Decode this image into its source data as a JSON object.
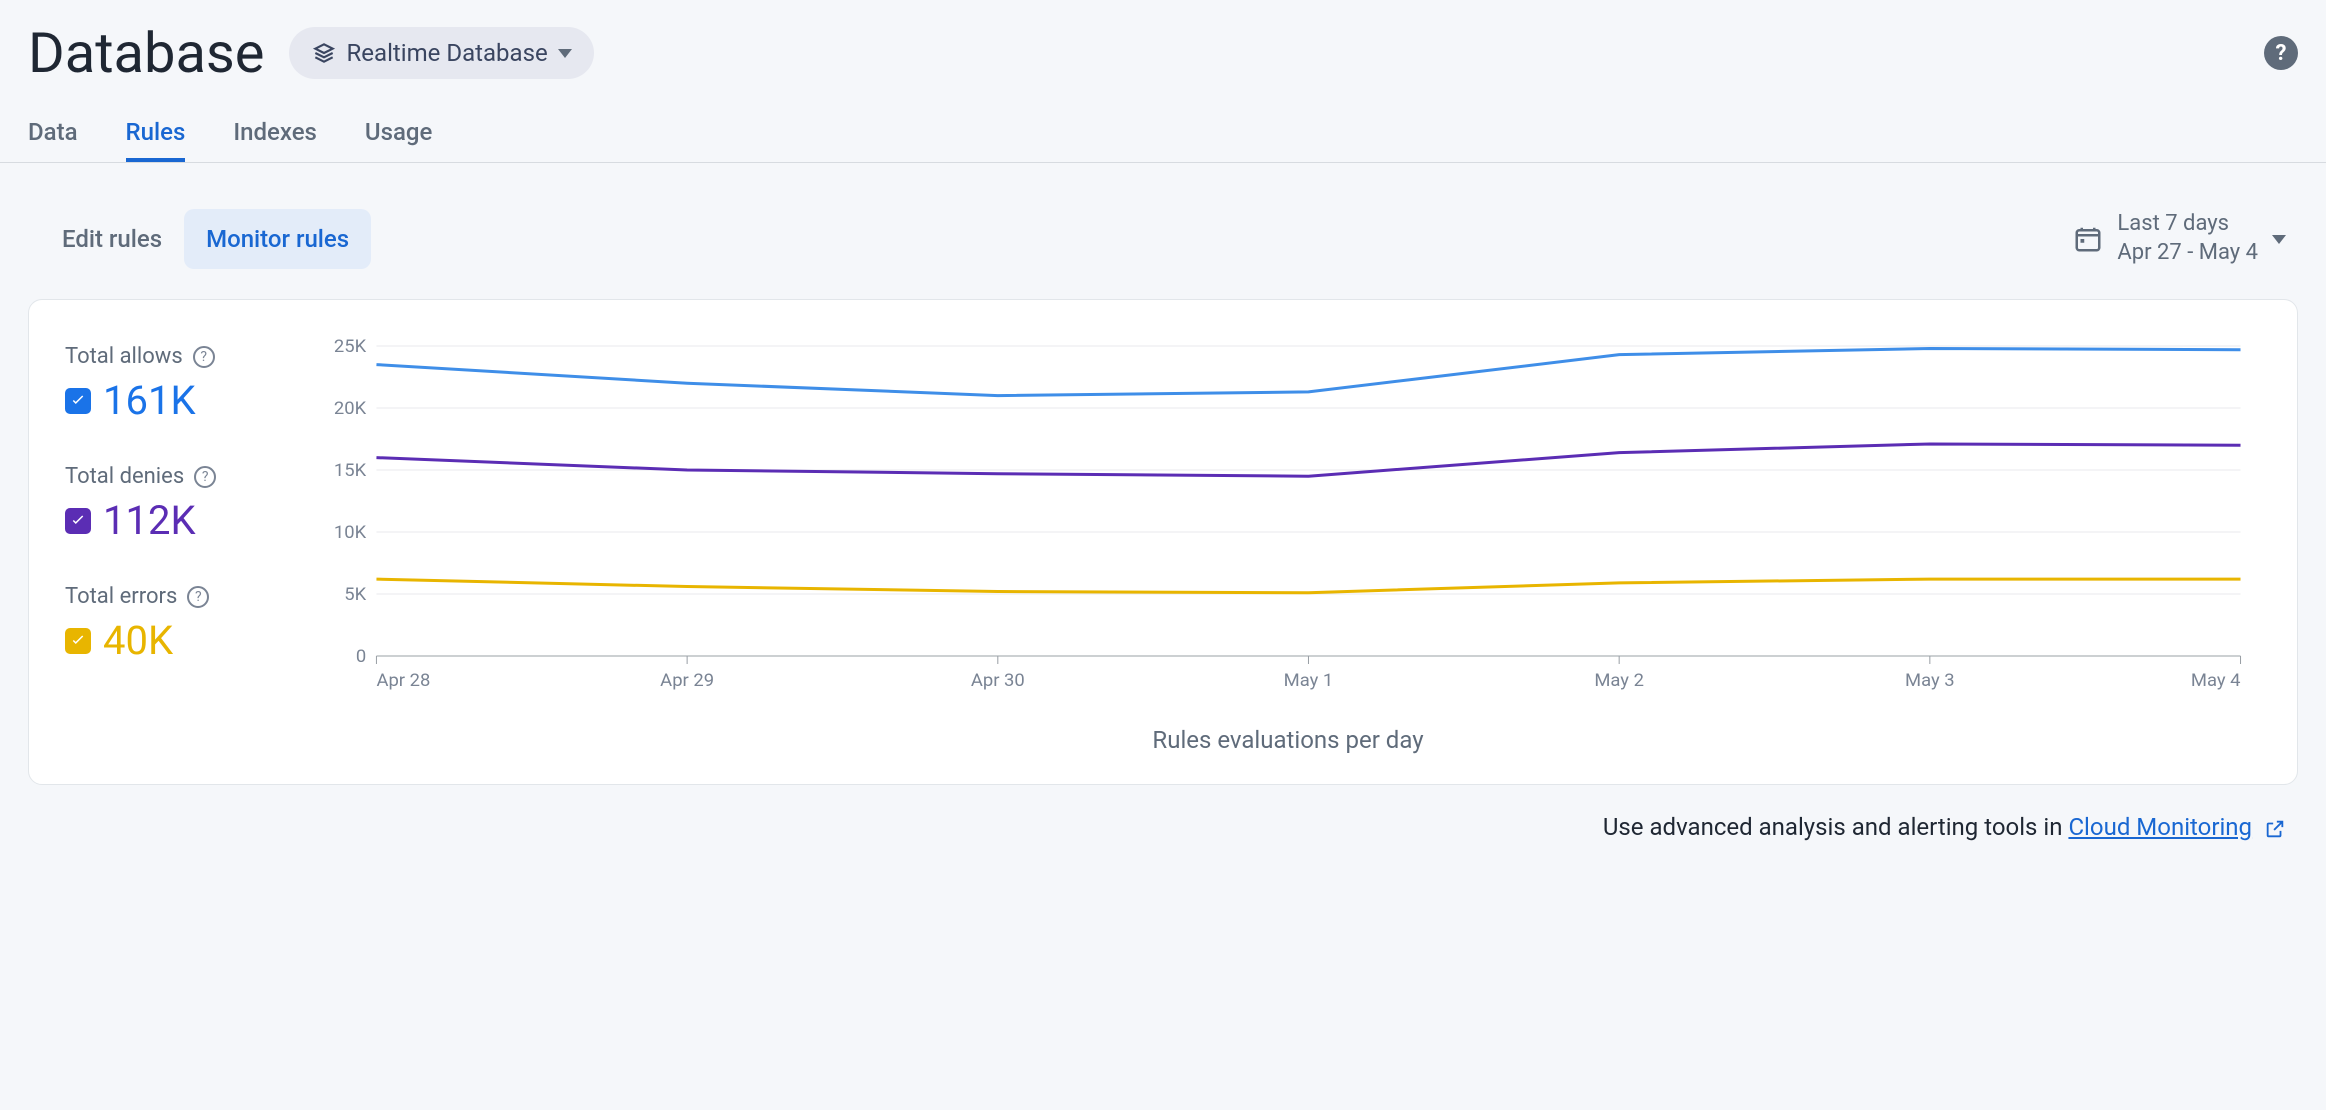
{
  "header": {
    "title": "Database",
    "db_selector_label": "Realtime Database"
  },
  "tabs": [
    "Data",
    "Rules",
    "Indexes",
    "Usage"
  ],
  "active_tab": "Rules",
  "subtabs": {
    "edit": "Edit rules",
    "monitor": "Monitor rules"
  },
  "active_subtab": "monitor",
  "date_picker": {
    "range_label": "Last 7 days",
    "range_dates": "Apr 27 - May 4"
  },
  "metrics": {
    "allows": {
      "label": "Total allows",
      "value": "161K",
      "color": "#1a73e8"
    },
    "denies": {
      "label": "Total denies",
      "value": "112K",
      "color": "#5b2db4"
    },
    "errors": {
      "label": "Total errors",
      "value": "40K",
      "color": "#e8b500"
    }
  },
  "chart_data": {
    "type": "line",
    "title": "",
    "xlabel": "Rules evaluations per day",
    "ylabel": "",
    "ylim": [
      0,
      25000
    ],
    "y_ticks": [
      0,
      5000,
      10000,
      15000,
      20000,
      25000
    ],
    "y_tick_labels": [
      "0",
      "5K",
      "10K",
      "15K",
      "20K",
      "25K"
    ],
    "categories": [
      "Apr 28",
      "Apr 29",
      "Apr 30",
      "May 1",
      "May 2",
      "May 3",
      "May 4"
    ],
    "series": [
      {
        "name": "Total allows",
        "color": "#3f8ee8",
        "values": [
          23500,
          22000,
          21000,
          21300,
          24300,
          24800,
          24700
        ]
      },
      {
        "name": "Total denies",
        "color": "#5b2db4",
        "values": [
          16000,
          15000,
          14700,
          14500,
          16400,
          17100,
          17000
        ]
      },
      {
        "name": "Total errors",
        "color": "#e8b500",
        "values": [
          6200,
          5600,
          5200,
          5100,
          5900,
          6200,
          6200
        ]
      }
    ]
  },
  "footer": {
    "prefix": "Use advanced analysis and alerting tools in ",
    "link_text": "Cloud Monitoring"
  }
}
